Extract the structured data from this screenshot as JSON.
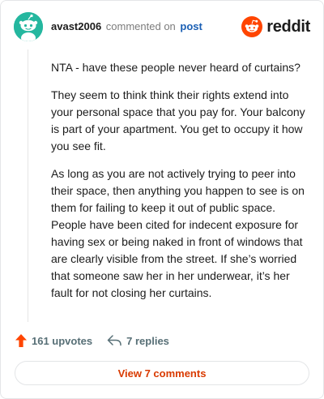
{
  "header": {
    "username": "avast2006",
    "commented_text": "commented on",
    "post_link": "post",
    "brand_name": "reddit"
  },
  "comment": {
    "paragraphs": [
      "NTA - have these people never heard of curtains?",
      "They seem to think think their rights extend into your personal space that you pay for. Your balcony is part of your apartment. You get to occupy it how you see fit.",
      "As long as you are not actively trying to peer into their space, then anything you happen to see is on them for failing to keep it out of public space. People have been cited for indecent exposure for having sex or being naked in front of windows that are clearly visible from the street. If she’s worried that someone saw her in her underwear, it’s her fault for not closing her curtains."
    ]
  },
  "actions": {
    "upvotes_label": "161 upvotes",
    "replies_label": "7 replies"
  },
  "footer": {
    "view_comments_label": "View 7 comments"
  },
  "colors": {
    "brand": "#ff4500",
    "avatar_bg": "#25b79f",
    "link": "#1a5fb4",
    "view_button_text": "#d93a00"
  },
  "icons": {
    "avatar": "snoo-avatar",
    "brand": "reddit-logo-icon",
    "upvote": "upvote-arrow-icon",
    "reply": "reply-arrow-icon"
  }
}
